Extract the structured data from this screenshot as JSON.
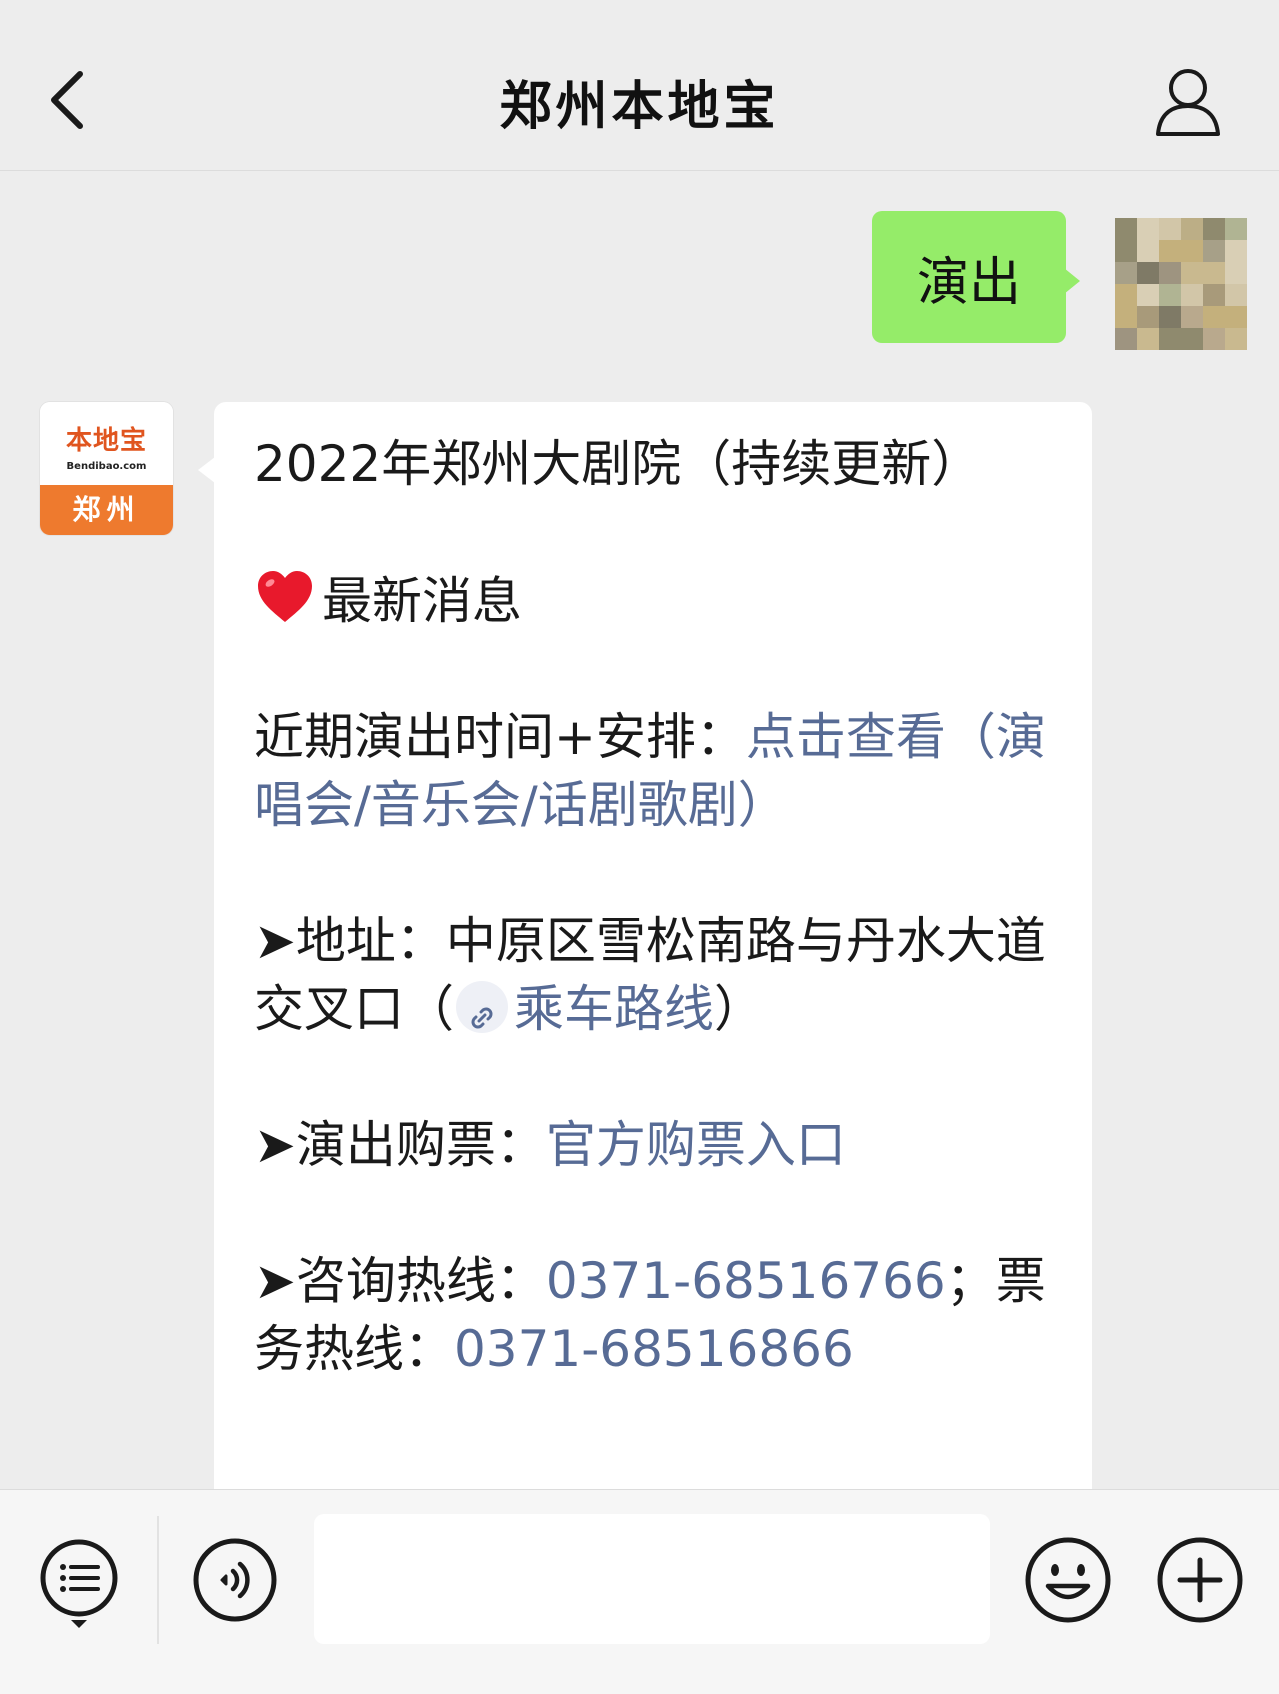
{
  "header": {
    "title": "郑州本地宝",
    "back_icon": "chevron-left-icon",
    "profile_icon": "person-icon"
  },
  "chat": {
    "outgoing": {
      "text": "演出",
      "bubble_color": "#95ec69"
    },
    "sender": {
      "brand_name": "本地宝",
      "brand_site": "Bendibao.com",
      "brand_city": "郑州",
      "accent": "#ee7a2e"
    },
    "incoming": {
      "title": "2022年郑州大剧院（持续更新）",
      "news_heading": "最新消息",
      "schedule_label": "近期演出时间+安排：",
      "schedule_link": "点击查看（演唱会/音乐会/话剧歌剧）",
      "address_label": "➤地址：",
      "address_text": "中原区雪松南路与丹水大道交叉口（",
      "route_link": "乘车路线",
      "address_close": "）",
      "ticket_label": "➤演出购票：",
      "ticket_link": "官方购票入口",
      "consult_label": "➤咨询热线：",
      "consult_number": "0371-68516766",
      "consult_sep": "；",
      "ticket_hotline_label": "票务热线：",
      "ticket_hotline_number": "0371-68516866",
      "link_color": "#576b95"
    }
  },
  "inputbar": {
    "menu_icon": "menu-list-icon",
    "voice_icon": "voice-icon",
    "input_value": "",
    "emoji_icon": "emoji-icon",
    "plus_icon": "plus-icon"
  }
}
